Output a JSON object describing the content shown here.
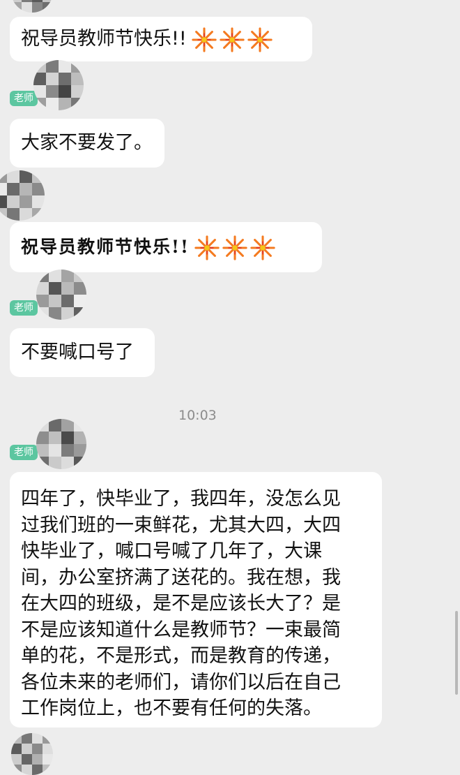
{
  "messages": [
    {
      "text": "祝导员教师节快乐!!",
      "emoji": "flower-emoji"
    },
    {
      "badge": "老师",
      "text": "大家不要发了。"
    },
    {
      "text": "祝导员教师节快乐!!",
      "emoji": "flower-emoji"
    },
    {
      "badge": "老师",
      "text": "不要喊口号了"
    }
  ],
  "timestamp": "10:03",
  "long_message": {
    "badge": "老师",
    "lines": [
      "四年了，快毕业了，我四年，没怎么见",
      "过我们班的一束鲜花，尤其大四，大四",
      "快毕业了，喊口号喊了几年了，大课",
      "间，办公室挤满了送花的。我在想，我",
      "在大四的班级，是不是应该长大了？是",
      "不是应该知道什么是教师节？一束最简",
      "单的花，不是形式，而是教育的传递，",
      "各位未来的老师们，请你们以后在自己",
      "工作岗位上，也不要有任何的失落。"
    ]
  },
  "colors": {
    "badge": "#5cc6a0",
    "background": "#ededed",
    "bubble": "#ffffff"
  }
}
